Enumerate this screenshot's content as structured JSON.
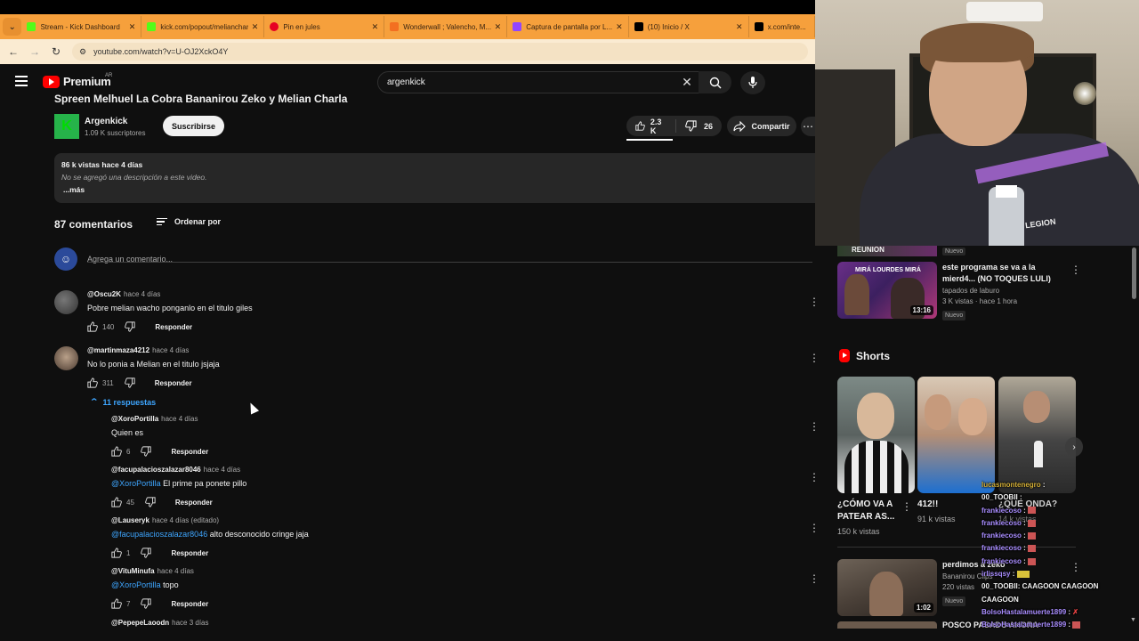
{
  "browser": {
    "tabs": [
      {
        "title": "Stream - Kick Dashboard",
        "color": "#53fc18"
      },
      {
        "title": "kick.com/popout/meliancharla/chat",
        "color": "#53fc18"
      },
      {
        "title": "Pin en jules",
        "color": "#e60023"
      },
      {
        "title": "Wonderwall ; Valencho, M...",
        "color": "#f36f21"
      },
      {
        "title": "Captura de pantalla por L...",
        "color": "#9146ff"
      },
      {
        "title": "(10) Inicio / X",
        "color": "#000000"
      },
      {
        "title": "x.com/inte...",
        "color": "#000000"
      }
    ],
    "url": "youtube.com/watch?v=U-OJ2XckO4Y"
  },
  "yt": {
    "logo": "Premium",
    "region": "AR",
    "search_value": "argenkick"
  },
  "video": {
    "title": "Spreen Melhuel La Cobra Bananirou Zeko y Melian Charla",
    "channel": "Argenkick",
    "subscribers": "1.09 K suscriptores",
    "subscribe_label": "Suscribirse",
    "likes": "2.3 K",
    "dislikes": "26",
    "share_label": "Compartir",
    "stats": "86 k vistas  hace 4 días",
    "description": "No se agregó una descripción a este video.",
    "more_label": "...más"
  },
  "comments_section": {
    "count_label": "87 comentarios",
    "sort_label": "Ordenar por",
    "add_placeholder": "Agrega un comentario...",
    "reply_label": "Responder",
    "replies_toggle": "11 respuestas",
    "comments": [
      {
        "author": "@Oscu2K",
        "time": "hace 4 días",
        "text": "Pobre melian wacho ponganlo en el titulo giles",
        "likes": "140"
      },
      {
        "author": "@martinmaza4212",
        "time": "hace 4 días",
        "text": "No lo ponia a Melian en el titulo jsjaja",
        "likes": "311"
      }
    ],
    "replies": [
      {
        "author": "@XoroPortilla",
        "time": "hace 4 días",
        "mention": "",
        "text": "Quien es",
        "likes": "6"
      },
      {
        "author": "@facupalacioszalazar8046",
        "time": "hace 4 días",
        "mention": "@XoroPortilla",
        "text": " El prime pa ponete pillo",
        "likes": "45"
      },
      {
        "author": "@Lauseryk",
        "time": "hace 4 días (editado)",
        "mention": "@facupalacioszalazar8046",
        "text": "  alto desconocido cringe jaja",
        "likes": "1"
      },
      {
        "author": "@VituMinufa",
        "time": "hace 4 días",
        "mention": "@XoroPortilla",
        "text": " topo",
        "likes": "7"
      },
      {
        "author": "@PepepeLaoodn",
        "time": "hace 3 días",
        "mention": "",
        "text": "",
        "likes": ""
      }
    ]
  },
  "sidebar": {
    "partial_top_badge": "Nuevo",
    "partial_top_text": "REUNION",
    "video1": {
      "title": "este programa se va a la mierd4... (NO TOQUES LULI)",
      "channel": "tapados de laburo",
      "meta": "3 K vistas · hace 1 hora",
      "badge": "Nuevo",
      "duration": "13:16",
      "overlay": "MIRÁ LOURDES MIRÁ"
    },
    "shorts_label": "Shorts",
    "shorts": [
      {
        "title": "¿CÓMO VA A PATEAR AS...",
        "views": "150 k vistas"
      },
      {
        "title": "412!!",
        "views": "91 k vistas"
      },
      {
        "title": "¿QUE ONDA?",
        "views": "14 k vistas"
      }
    ],
    "video2": {
      "title": "perdimos a zeko",
      "channel": "Bananirou Clips",
      "meta": "220 vistas",
      "badge": "Nuevo",
      "duration": "1:02"
    },
    "partial_bottom": "POSCO PASADO AHORA"
  },
  "chat": [
    {
      "user": "lucasmontenegro",
      "msg": ":",
      "color": "#d4af37"
    },
    {
      "user": "00_TOOBII",
      "msg": ":",
      "color": "#f1f1f1"
    },
    {
      "user": "frankiecoso",
      "msg": ":",
      "color": "#a98dff"
    },
    {
      "user": "frankiecoso",
      "msg": ":",
      "color": "#a98dff"
    },
    {
      "user": "frankiecoso",
      "msg": ":",
      "color": "#a98dff"
    },
    {
      "user": "frankiecoso",
      "msg": ":",
      "color": "#a98dff"
    },
    {
      "user": "frankiecoso",
      "msg": ":",
      "color": "#a98dff"
    },
    {
      "user": "irlissqsy",
      "msg": ":",
      "color": "#a98dff"
    },
    {
      "user": "00_TOOBII",
      "msg": ": CAAGOON CAAGOON",
      "color": "#f1f1f1"
    },
    {
      "user": "",
      "msg": "CAAGOON",
      "color": "#f1f1f1"
    },
    {
      "user": "BolsoHastalamuerte1899",
      "msg": ":",
      "color": "#a98dff"
    },
    {
      "user": "BolsoHastalamuerte1899",
      "msg": ":",
      "color": "#a98dff"
    }
  ]
}
